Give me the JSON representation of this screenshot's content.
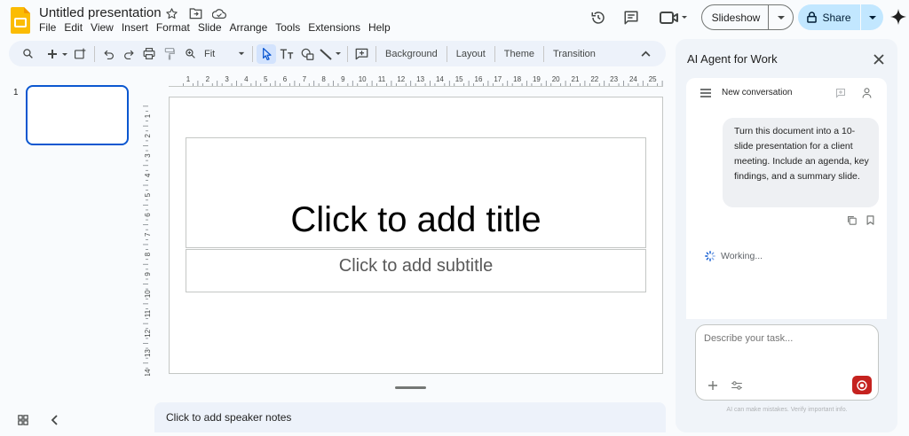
{
  "app": {
    "name": "Google Slides"
  },
  "document": {
    "title": "Untitled presentation"
  },
  "menu": [
    "File",
    "Edit",
    "View",
    "Insert",
    "Format",
    "Slide",
    "Arrange",
    "Tools",
    "Extensions",
    "Help"
  ],
  "header": {
    "slideshow_label": "Slideshow",
    "share_label": "Share"
  },
  "toolbar": {
    "zoom_value": "Fit",
    "background_label": "Background",
    "layout_label": "Layout",
    "theme_label": "Theme",
    "transition_label": "Transition"
  },
  "filmstrip": {
    "slide_number": "1"
  },
  "ruler": {
    "horizontal_ticks": [
      "1",
      "2",
      "3",
      "4",
      "5",
      "6",
      "7",
      "8",
      "9",
      "10",
      "11",
      "12",
      "13",
      "14",
      "15",
      "16",
      "17",
      "18",
      "19",
      "20",
      "21",
      "22",
      "23",
      "24",
      "25"
    ],
    "vertical_ticks": [
      "1",
      "2",
      "3",
      "4",
      "5",
      "6",
      "7",
      "8",
      "9",
      "10",
      "11",
      "12",
      "13",
      "14"
    ]
  },
  "slide": {
    "title_placeholder": "Click to add title",
    "subtitle_placeholder": "Click to add subtitle"
  },
  "notes": {
    "placeholder": "Click to add speaker notes"
  },
  "panel": {
    "title": "AI Agent for Work",
    "conversation_title": "New conversation",
    "user_message": "Turn this document into a 10-slide presentation for a client meeting. Include an agenda, key findings, and a summary slide.",
    "status": "Working...",
    "input_placeholder": "Describe your task...",
    "disclaimer": "AI can make mistakes. Verify important info."
  },
  "colors": {
    "accent": "#0b57d0",
    "share_bg": "#c2e7ff",
    "toolbar_bg": "#edf2fa",
    "record_button": "#c5221f",
    "logo_yellow": "#fbbc04"
  },
  "icons": [
    "slides-logo",
    "star-icon",
    "move-folder-icon",
    "cloud-saved-icon",
    "history-icon",
    "comment-icon",
    "video-call-icon",
    "lock-icon",
    "gemini-sparkle-icon",
    "search-icon",
    "new-slide-icon",
    "undo-icon",
    "redo-icon",
    "print-icon",
    "paint-format-icon",
    "zoom-icon",
    "select-icon",
    "text-box-icon",
    "shape-icon",
    "line-icon",
    "comment-add-icon",
    "grid-view-icon",
    "collapse-panel-icon",
    "close-icon",
    "menu-icon",
    "new-chat-icon",
    "account-icon",
    "copy-icon",
    "bookmark-icon",
    "spinner-icon",
    "add-icon",
    "settings-sliders-icon",
    "record-icon"
  ]
}
